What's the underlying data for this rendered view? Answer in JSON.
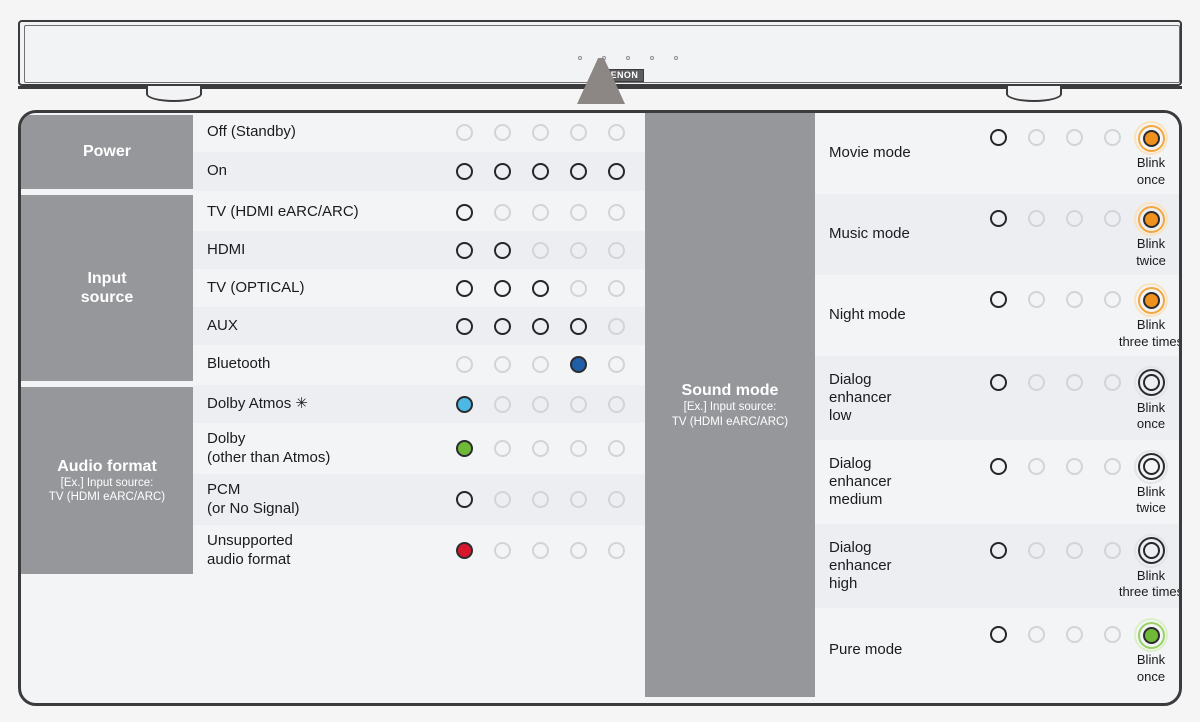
{
  "device": {
    "brand_logo": "DENON",
    "led_dot_count": 5
  },
  "left_panel": {
    "groups": [
      {
        "title": "Power",
        "subtitle": "",
        "rows": [
          {
            "label": "Off (Standby)",
            "leds": [
              "off",
              "off",
              "off",
              "off",
              "off"
            ]
          },
          {
            "label": "On",
            "leds": [
              "white",
              "white",
              "white",
              "white",
              "white"
            ]
          }
        ]
      },
      {
        "title": "Input\nsource",
        "subtitle": "",
        "rows": [
          {
            "label": "TV (HDMI eARC/ARC)",
            "leds": [
              "white",
              "off",
              "off",
              "off",
              "off"
            ]
          },
          {
            "label": "HDMI",
            "leds": [
              "white",
              "white",
              "off",
              "off",
              "off"
            ]
          },
          {
            "label": "TV (OPTICAL)",
            "leds": [
              "white",
              "white",
              "white",
              "off",
              "off"
            ]
          },
          {
            "label": "AUX",
            "leds": [
              "white",
              "white",
              "white",
              "white",
              "off"
            ]
          },
          {
            "label": "Bluetooth",
            "leds": [
              "off",
              "off",
              "off",
              "blue",
              "off"
            ]
          }
        ]
      },
      {
        "title": "Audio format",
        "subtitle": "[Ex.] Input source:\nTV (HDMI eARC/ARC)",
        "rows": [
          {
            "label": "Dolby Atmos ✳",
            "leds": [
              "cyan",
              "off",
              "off",
              "off",
              "off"
            ]
          },
          {
            "label": "Dolby\n(other than Atmos)",
            "leds": [
              "green",
              "off",
              "off",
              "off",
              "off"
            ]
          },
          {
            "label": "PCM\n(or No Signal)",
            "leds": [
              "white",
              "off",
              "off",
              "off",
              "off"
            ]
          },
          {
            "label": "Unsupported\naudio format",
            "leds": [
              "red",
              "off",
              "off",
              "off",
              "off"
            ]
          }
        ]
      }
    ]
  },
  "right_panel": {
    "group": {
      "title": "Sound mode",
      "subtitle": "[Ex.] Input source:\nTV (HDMI eARC/ARC)"
    },
    "rows": [
      {
        "label": "Movie mode",
        "leds": [
          "white",
          "off",
          "off",
          "off"
        ],
        "blink_color": "orange",
        "blink_caption": "Blink\nonce"
      },
      {
        "label": "Music mode",
        "leds": [
          "white",
          "off",
          "off",
          "off"
        ],
        "blink_color": "orange",
        "blink_caption": "Blink\ntwice"
      },
      {
        "label": "Night mode",
        "leds": [
          "white",
          "off",
          "off",
          "off"
        ],
        "blink_color": "orange",
        "blink_caption": "Blink\nthree times"
      },
      {
        "label": "Dialog\nenhancer\nlow",
        "leds": [
          "white",
          "off",
          "off",
          "off"
        ],
        "blink_color": "white",
        "blink_caption": "Blink\nonce"
      },
      {
        "label": "Dialog\nenhancer\nmedium",
        "leds": [
          "white",
          "off",
          "off",
          "off"
        ],
        "blink_color": "white",
        "blink_caption": "Blink\ntwice"
      },
      {
        "label": "Dialog\nenhancer\nhigh",
        "leds": [
          "white",
          "off",
          "off",
          "off"
        ],
        "blink_color": "white",
        "blink_caption": "Blink\nthree times"
      },
      {
        "label": "Pure mode",
        "leds": [
          "white",
          "off",
          "off",
          "off"
        ],
        "blink_color": "green",
        "blink_caption": "Blink\nonce"
      }
    ]
  },
  "colors": {
    "group_label_bg": "#96979b",
    "panel_bg": "#f3f4f6",
    "row_alt_bg": "#eceef1",
    "border": "#3b3b3d",
    "led_off": "#d2d4d8",
    "led_white": "#26272a",
    "led_blue": "#1f5fa8",
    "led_cyan": "#4cb8e3",
    "led_green": "#6fb936",
    "led_red": "#d8172c",
    "led_orange": "#f0901d"
  }
}
